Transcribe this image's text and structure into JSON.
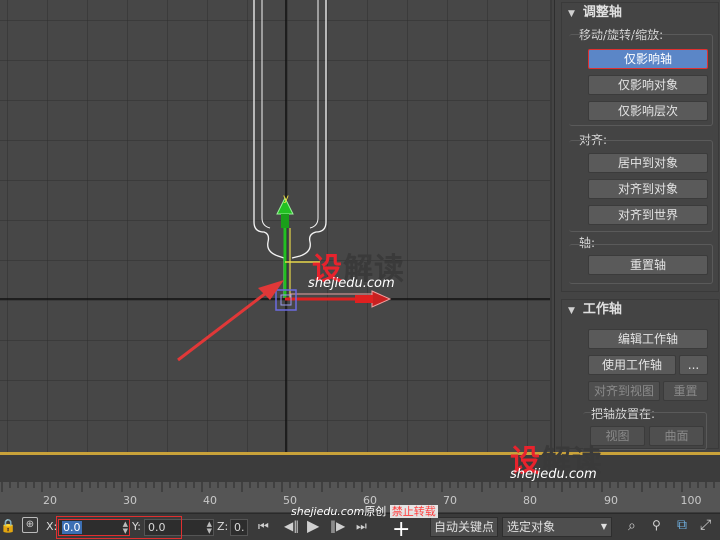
{
  "panel": {
    "adjust_pivot": {
      "title": "调整轴",
      "move_group_label": "移动/旋转/缩放:",
      "affect_pivot_only": "仅影响轴",
      "affect_object_only": "仅影响对象",
      "affect_hierarchy_only": "仅影响层次",
      "align_group_label": "对齐:",
      "center_to_object": "居中到对象",
      "align_to_object": "对齐到对象",
      "align_to_world": "对齐到世界",
      "pivot_group_label": "轴:",
      "reset_pivot": "重置轴"
    },
    "working_pivot": {
      "title": "工作轴",
      "edit_working_pivot": "编辑工作轴",
      "use_working_pivot": "使用工作轴",
      "more": "...",
      "align_to_view": "对齐到视图",
      "reset": "重置",
      "place_pivot_label": "把轴放置在:",
      "view": "视图",
      "surface": "曲面"
    }
  },
  "viewport": {
    "gizmo_axis_label": "y"
  },
  "watermarks": [
    {
      "logo_a": "设",
      "logo_b": "解读",
      "url": "shejiedu.com"
    },
    {
      "logo_a": "设",
      "logo_b": "解读",
      "url": "shejiedu.com"
    }
  ],
  "overlay": {
    "url": "shejiedu.com",
    "original": "原创",
    "no_repost": "禁止转载"
  },
  "timeline": {
    "ticks": [
      "20",
      "30",
      "40",
      "50",
      "60",
      "70",
      "80",
      "90",
      "100"
    ]
  },
  "statusbar": {
    "x_label": "X:",
    "x_value": "0.0",
    "y_label": "Y:",
    "y_value": "0.0",
    "z_label": "Z:",
    "z_value": "0.",
    "auto_key": "自动关键点",
    "selection_mode": "选定对象"
  },
  "colors": {
    "accent_blue": "#5b86c7",
    "highlight_red": "#e03030",
    "gizmo_green": "#22c022",
    "gizmo_red": "#e02020",
    "frame_gold": "#c9a23a"
  }
}
